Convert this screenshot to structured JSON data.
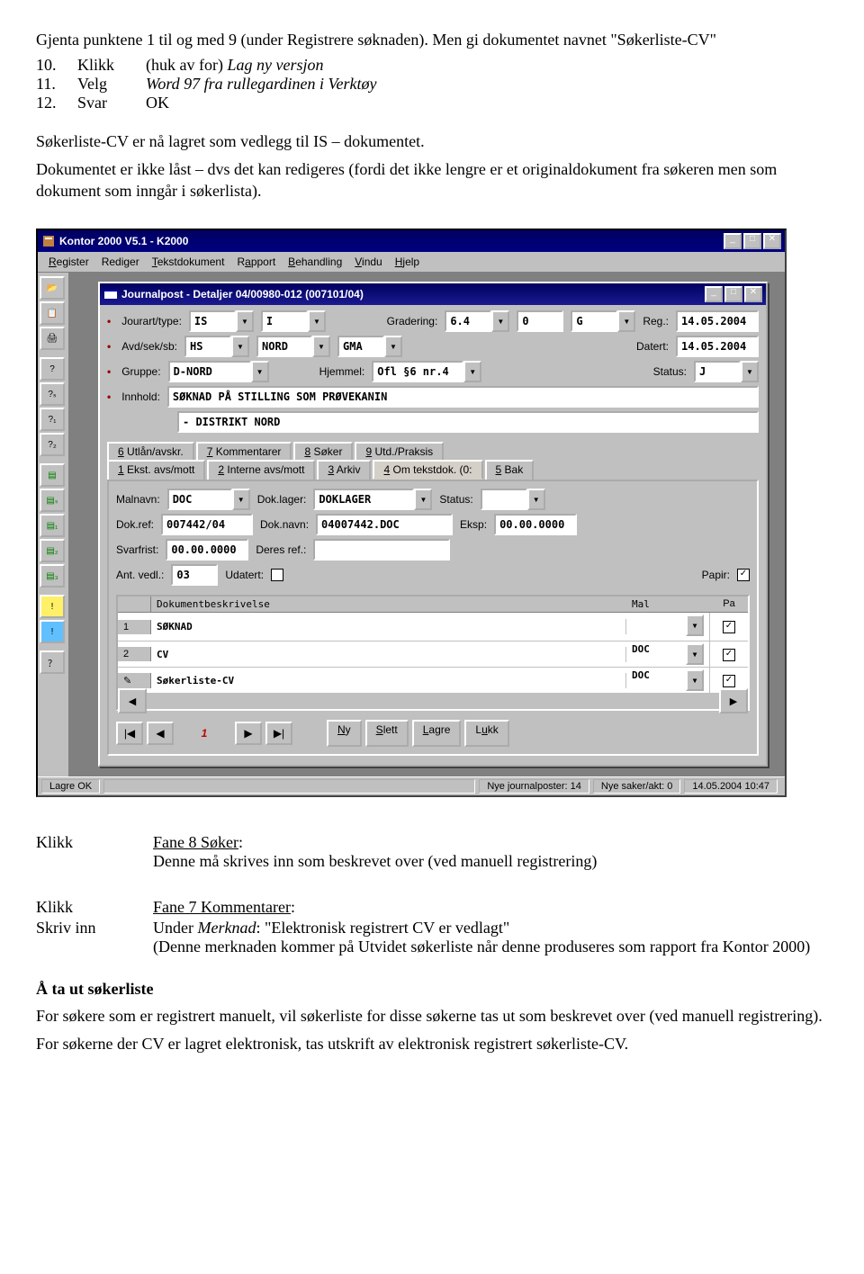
{
  "intro": {
    "line1": "Gjenta punktene 1 til og med 9 (under Registrere søknaden). Men gi dokumentet navnet \"Søkerliste-CV\"",
    "steps": [
      {
        "n": "10.",
        "cmd": "Klikk",
        "rest_a": "(huk av for) ",
        "rest_em": "Lag ny versjon"
      },
      {
        "n": "11.",
        "cmd": "Velg",
        "rest_em": "Word 97 fra rullegardinen i Verktøy"
      },
      {
        "n": "12.",
        "cmd": "Svar",
        "rest_a": "OK"
      }
    ],
    "para2": "Søkerliste-CV er nå lagret som vedlegg til IS – dokumentet.",
    "para3": "Dokumentet er ikke låst – dvs det kan redigeres (fordi det ikke lengre er et originaldokument fra søkeren men som dokument som inngår i søkerlista)."
  },
  "app": {
    "outer_title": "Kontor 2000 V5.1 - K2000",
    "menus": [
      "Register",
      "Rediger",
      "Tekstdokument",
      "Rapport",
      "Behandling",
      "Vindu",
      "Hjelp"
    ],
    "child_title": "Journalpost - Detaljer 04/00980-012 (007101/04)",
    "header_labels": {
      "jourart": "Jourart/type:",
      "avd": "Avd/sek/sb:",
      "gruppe": "Gruppe:",
      "innhold": "Innhold:",
      "grad": "Gradering:",
      "hjemmel": "Hjemmel:",
      "reg": "Reg.:",
      "datert": "Datert:",
      "status": "Status:"
    },
    "header_values": {
      "jourart1": "IS",
      "jourart2": "I",
      "avd1": "HS",
      "avd2": "NORD",
      "avd3": "GMA",
      "gruppe": "D-NORD",
      "innhold_line1": "SØKNAD PÅ STILLING SOM PRØVEKANIN",
      "innhold_line2": "- DISTRIKT NORD",
      "grad1": "6.4",
      "grad2": "0",
      "grad3": "G",
      "hjemmel": "Ofl §6 nr.4",
      "reg": "14.05.2004",
      "datert": "14.05.2004",
      "status": "J"
    },
    "tabs_top": [
      {
        "u": "6",
        "rest": " Utlån/avskr."
      },
      {
        "u": "7",
        "rest": " Kommentarer"
      },
      {
        "u": "8",
        "rest": " Søker"
      },
      {
        "u": "9",
        "rest": " Utd./Praksis"
      }
    ],
    "tabs_bot": [
      {
        "u": "1",
        "rest": " Ekst. avs/mott"
      },
      {
        "u": "2",
        "rest": " Interne avs/mott"
      },
      {
        "u": "3",
        "rest": " Arkiv"
      },
      {
        "u": "4",
        "rest": " Om tekstdok. (0:"
      },
      {
        "u": "5",
        "rest": " Bak"
      }
    ],
    "panel_labels": {
      "malnavn": "Malnavn:",
      "dokref": "Dok.ref:",
      "svarfrist": "Svarfrist:",
      "antvedl": "Ant. vedl.:",
      "doklager": "Dok.lager:",
      "doknavn": "Dok.navn:",
      "deresref": "Deres ref.:",
      "udatert": "Udatert:",
      "status": "Status:",
      "eksp": "Eksp:",
      "papir": "Papir:"
    },
    "panel_values": {
      "malnavn": "DOC",
      "dokref": "007442/04",
      "svarfrist": "00.00.0000",
      "antvedl": "03",
      "doklager": "DOKLAGER",
      "doknavn": "04007442.DOC",
      "deresref": "",
      "status": "",
      "eksp": "00.00.0000"
    },
    "doc_table": {
      "hdr": {
        "desc": "Dokumentbeskrivelse",
        "mal": "Mal",
        "pa": "Pa"
      },
      "rows": [
        {
          "n": "1",
          "desc": "SØKNAD",
          "mal": "",
          "pa": "✓"
        },
        {
          "n": "2",
          "desc": "CV",
          "mal": "DOC",
          "pa": "✓"
        },
        {
          "n": "",
          "desc": "Søkerliste-CV",
          "mal": "DOC",
          "pa": "✓"
        }
      ]
    },
    "nav": {
      "record": "1",
      "btns": [
        "|◀",
        "◀",
        "▶",
        "▶|"
      ],
      "form": [
        "Ny",
        "Slett",
        "Lagre",
        "Lukk"
      ]
    },
    "status": {
      "left": "Lagre OK",
      "mid1": "Nye journalposter: 14",
      "mid2": "Nye saker/akt: 0",
      "right": "14.05.2004 10:47"
    }
  },
  "lower": {
    "rows": [
      {
        "k": "Klikk",
        "title_u": "Fane 8 Søker",
        "rest": "Denne må skrives inn som beskrevet over (ved manuell registrering)"
      }
    ],
    "row2_k1": "Klikk",
    "row2_v1_u": "Fane 7 Kommentarer",
    "row2_k2": "Skriv inn",
    "row2_v2_pre": "Under ",
    "row2_v2_em": "Merknad",
    "row2_v2_post": ": \"Elektronisk registrert CV er vedlagt\"",
    "row2_v2_cont": "(Denne merknaden kommer på Utvidet søkerliste når denne produseres som rapport fra Kontor 2000)",
    "head": "Å ta ut søkerliste",
    "p1": "For søkere som er registrert manuelt, vil søkerliste for disse søkerne tas ut som beskrevet over (ved manuell registrering).",
    "p2": "For søkerne der CV er lagret elektronisk, tas utskrift av elektronisk registrert søkerliste-CV."
  }
}
